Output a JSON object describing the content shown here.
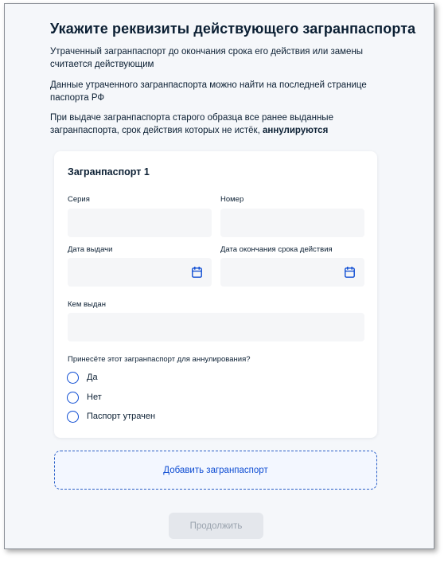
{
  "page": {
    "title": "Укажите реквизиты действующего загранпаспорта",
    "info_1": "Утраченный загранпаспорт до окончания срока его действия или замены считается действующим",
    "info_2": "Данные утраченного загранпаспорта можно найти на последней странице паспорта РФ",
    "info_3_text": "При выдаче загранпаспорта старого образца все ранее выданные загранпаспорта, срок действия которых не истёк, ",
    "info_3_bold": "аннулируются"
  },
  "passport_card": {
    "title": "Загранпаспорт 1",
    "series_label": "Серия",
    "series_value": "",
    "number_label": "Номер",
    "number_value": "",
    "issue_date_label": "Дата выдачи",
    "issue_date_value": "",
    "expiry_date_label": "Дата окончания срока действия",
    "expiry_date_value": "",
    "issued_by_label": "Кем выдан",
    "issued_by_value": "",
    "question": "Принесёте этот загранпаспорт для аннулирования?",
    "options": [
      "Да",
      "Нет",
      "Паспорт утрачен"
    ],
    "calendar_icon": "calendar-icon"
  },
  "actions": {
    "add_passport": "Добавить загранпаспорт",
    "continue": "Продолжить"
  },
  "colors": {
    "accent": "#0d4cd3",
    "field_bg": "#f5f6f8",
    "page_bg": "#f5f7fa",
    "disabled_bg": "#e4e7ec",
    "disabled_text": "#9aa3ae"
  }
}
